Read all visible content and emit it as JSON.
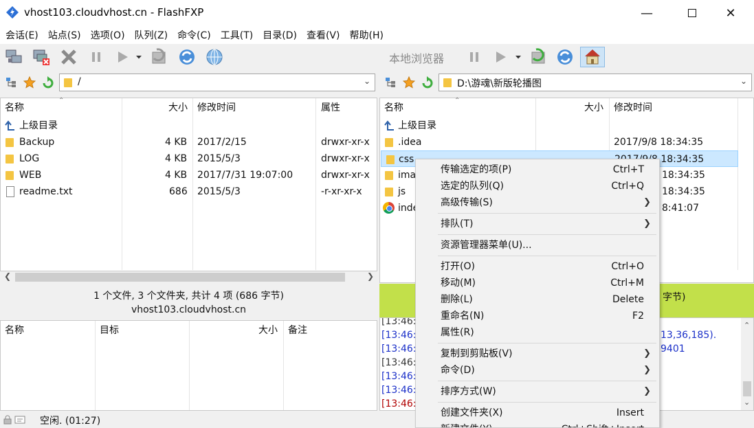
{
  "window": {
    "title": "vhost103.cloudvhost.cn - FlashFXP"
  },
  "menu": [
    "会话(E)",
    "站点(S)",
    "选项(O)",
    "队列(Z)",
    "命令(C)",
    "工具(T)",
    "目录(D)",
    "查看(V)",
    "帮助(H)"
  ],
  "toolbar_right": {
    "local_label": "本地浏览器"
  },
  "left": {
    "path": "/",
    "columns": [
      "名称",
      "大小",
      "修改时间",
      "属性"
    ],
    "rows": [
      {
        "name": "上级目录",
        "size": "",
        "date": "",
        "attr": "",
        "type": "up"
      },
      {
        "name": "Backup",
        "size": "4 KB",
        "date": "2017/2/15",
        "attr": "drwxr-xr-x",
        "type": "folder"
      },
      {
        "name": "LOG",
        "size": "4 KB",
        "date": "2015/5/3",
        "attr": "drwxr-xr-x",
        "type": "folder"
      },
      {
        "name": "WEB",
        "size": "4 KB",
        "date": "2017/7/31 19:07:00",
        "attr": "drwxr-xr-x",
        "type": "folder"
      },
      {
        "name": "readme.txt",
        "size": "686",
        "date": "2015/5/3",
        "attr": "-r-xr-xr-x",
        "type": "file"
      }
    ],
    "status_line1": "1 个文件, 3 个文件夹, 共计 4 项 (686 字节)",
    "status_line2": "vhost103.cloudvhost.cn"
  },
  "right": {
    "path": "D:\\游魂\\新版轮播图",
    "columns": [
      "名称",
      "大小",
      "修改时间"
    ],
    "rows": [
      {
        "name": "上级目录",
        "date": "",
        "type": "up"
      },
      {
        "name": ".idea",
        "date": "2017/9/8 18:34:35",
        "type": "folder"
      },
      {
        "name": "css",
        "date": "2017/9/8 18:34:35",
        "type": "folder",
        "selected": true
      },
      {
        "name": "ima",
        "date": "18:34:35",
        "type": "folder"
      },
      {
        "name": "js",
        "date": "18:34:35",
        "type": "folder"
      },
      {
        "name": "inde",
        "date": "8:41:07",
        "type": "chrome"
      }
    ],
    "status_text": "字节)"
  },
  "queue": {
    "columns": [
      "名称",
      "目标",
      "大小",
      "备注"
    ]
  },
  "log": {
    "lines": [
      {
        "text": "[13:46:",
        "color": "#333333"
      },
      {
        "text": "[13:46:",
        "color": "#1a2fc8",
        "tail": "13,36,185)."
      },
      {
        "text": "[13:46:",
        "color": "#1a2fc8",
        "tail": "9401"
      },
      {
        "text": "[13:46:",
        "color": "#333333"
      },
      {
        "text": "[13:46:",
        "color": "#1a2fc8"
      },
      {
        "text": "[13:46:",
        "color": "#1a2fc8"
      },
      {
        "text": "[13:46:",
        "color": "#b00000"
      }
    ]
  },
  "statusbar": {
    "text": "空闲. (01:27)"
  },
  "context_menu": {
    "items": [
      {
        "label": "传输选定的项(P)",
        "shortcut": "Ctrl+T"
      },
      {
        "label": "选定的队列(Q)",
        "shortcut": "Ctrl+Q"
      },
      {
        "label": "高级传输(S)",
        "submenu": true
      },
      {
        "sep": true
      },
      {
        "label": "排队(T)",
        "submenu": true
      },
      {
        "sep": true
      },
      {
        "label": "资源管理器菜单(U)..."
      },
      {
        "sep": true
      },
      {
        "label": "打开(O)",
        "shortcut": "Ctrl+O"
      },
      {
        "label": "移动(M)",
        "shortcut": "Ctrl+M"
      },
      {
        "label": "删除(L)",
        "shortcut": "Delete"
      },
      {
        "label": "重命名(N)",
        "shortcut": "F2"
      },
      {
        "label": "属性(R)"
      },
      {
        "sep": true
      },
      {
        "label": "复制到剪贴板(V)",
        "submenu": true
      },
      {
        "label": "命令(D)",
        "submenu": true
      },
      {
        "sep": true
      },
      {
        "label": "排序方式(W)",
        "submenu": true
      },
      {
        "sep": true
      },
      {
        "label": "创建文件夹(X)",
        "shortcut": "Insert"
      },
      {
        "label": "新建文件(Y)",
        "shortcut": "Ctrl+Shift+Insert"
      }
    ]
  },
  "colors": {
    "selection": "#cce8ff",
    "status_green": "#c2e04a",
    "folder": "#f4c542"
  }
}
